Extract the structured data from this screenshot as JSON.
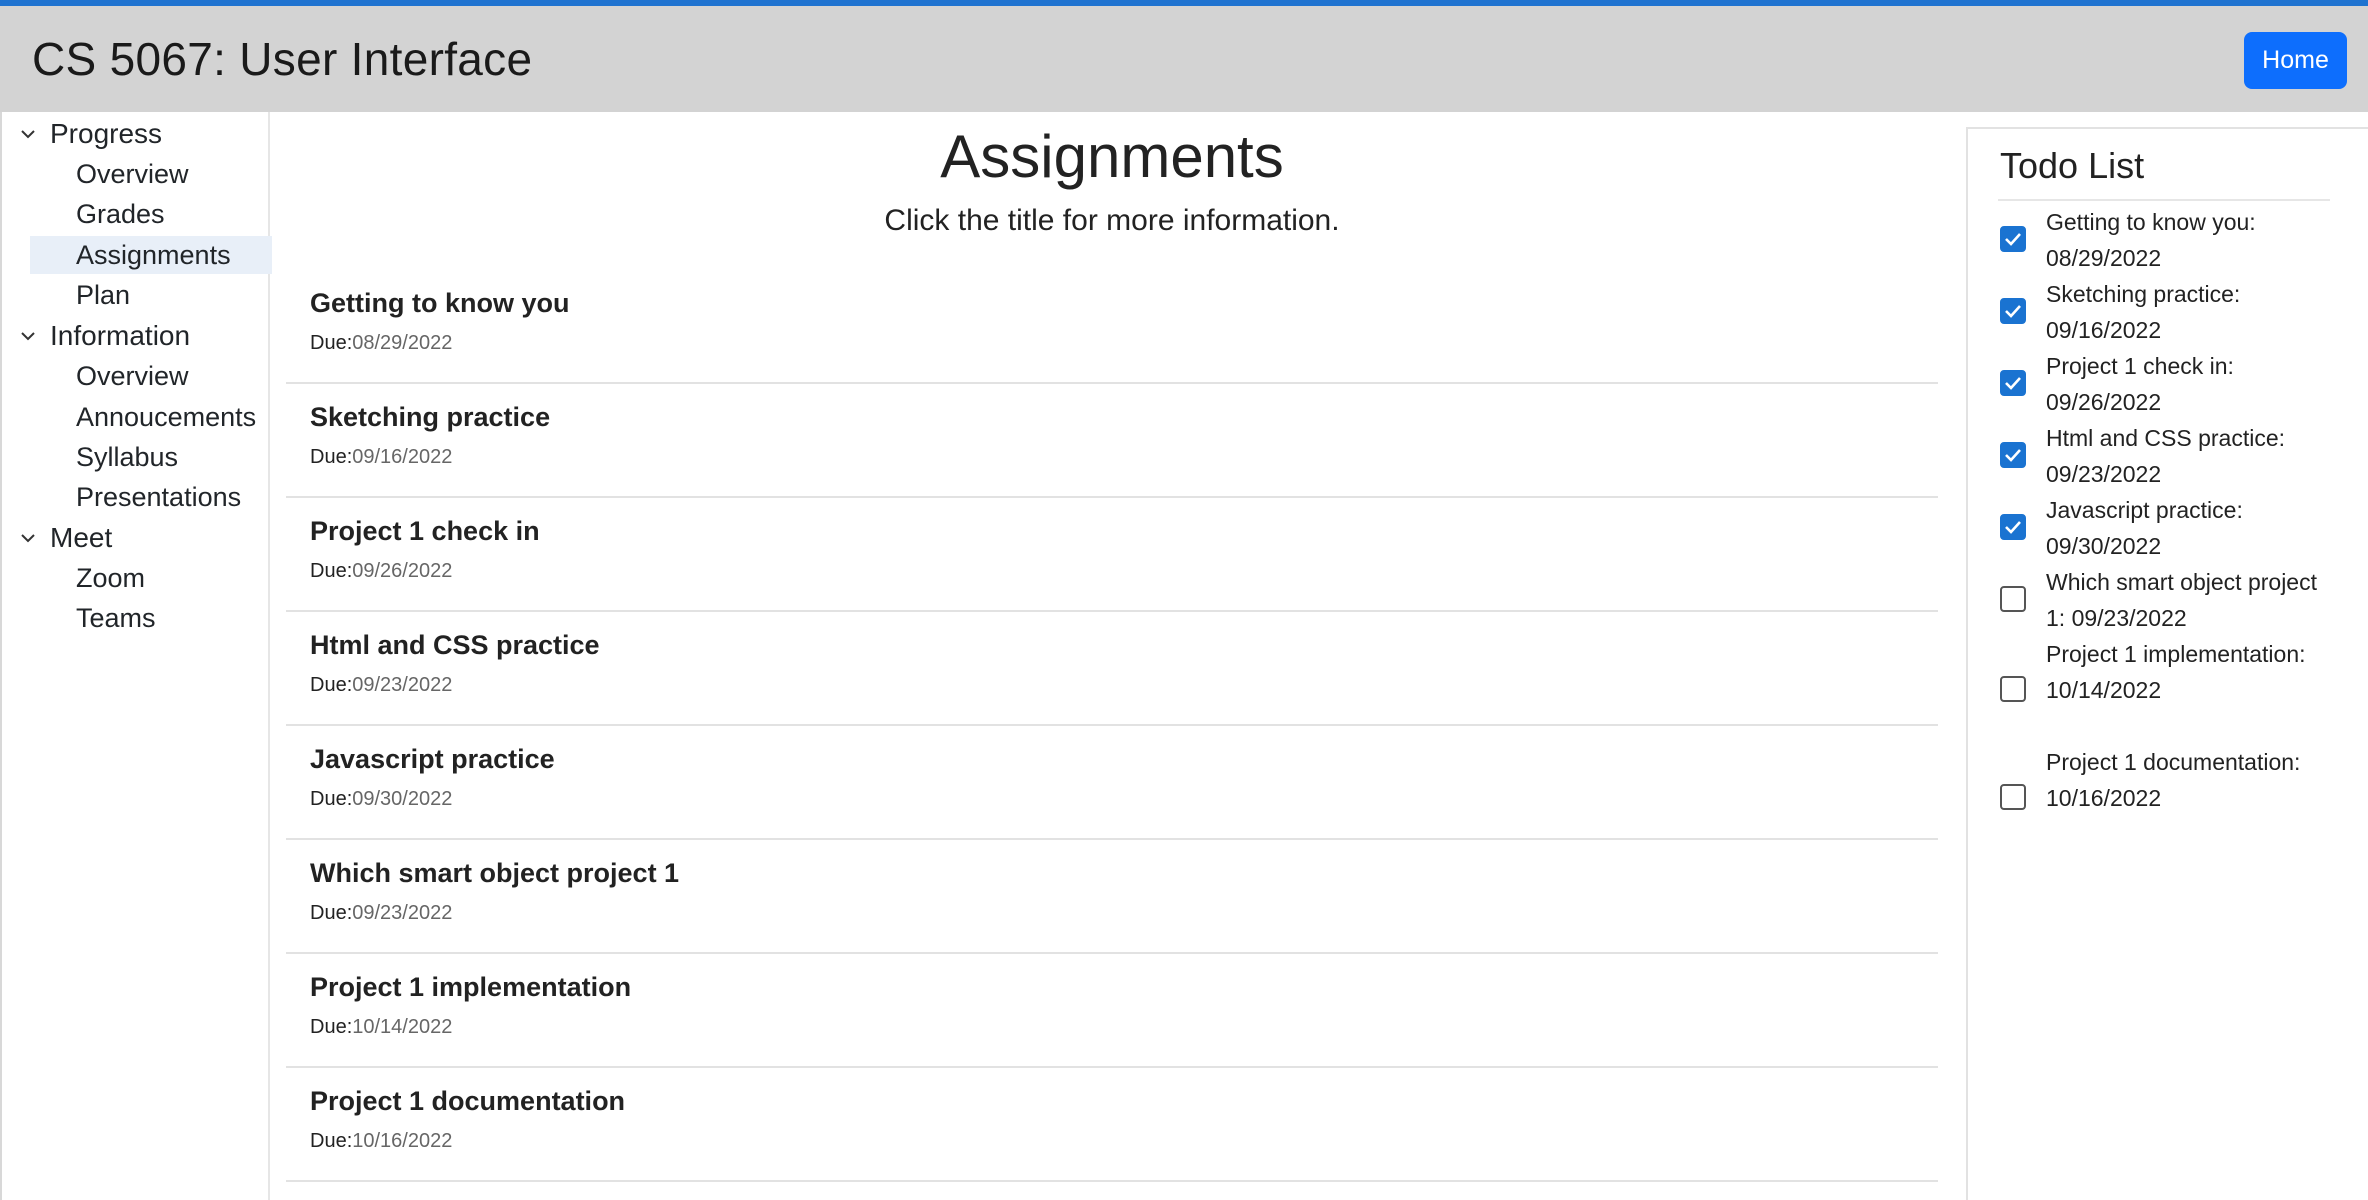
{
  "header": {
    "title": "CS 5067: User Interface",
    "home_label": "Home"
  },
  "sidebar": {
    "groups": [
      {
        "label": "Progress",
        "items": [
          "Overview",
          "Grades",
          "Assignments",
          "Plan"
        ]
      },
      {
        "label": "Information",
        "items": [
          "Overview",
          "Annoucements",
          "Syllabus",
          "Presentations"
        ]
      },
      {
        "label": "Meet",
        "items": [
          "Zoom",
          "Teams"
        ]
      }
    ],
    "active_item": "Assignments"
  },
  "main": {
    "title": "Assignments",
    "subtitle": "Click the title for more information.",
    "due_prefix": "Due:",
    "assignments": [
      {
        "title": "Getting to know you",
        "due": "08/29/2022"
      },
      {
        "title": "Sketching practice",
        "due": "09/16/2022"
      },
      {
        "title": "Project 1 check in",
        "due": "09/26/2022"
      },
      {
        "title": "Html and CSS practice",
        "due": "09/23/2022"
      },
      {
        "title": "Javascript practice",
        "due": "09/30/2022"
      },
      {
        "title": "Which smart object project 1",
        "due": "09/23/2022"
      },
      {
        "title": "Project 1 implementation",
        "due": "10/14/2022"
      },
      {
        "title": "Project 1 documentation",
        "due": "10/16/2022"
      }
    ]
  },
  "todo": {
    "title": "Todo List",
    "items": [
      {
        "text": "Getting to know you: 08/29/2022",
        "checked": true
      },
      {
        "text": "Sketching practice: 09/16/2022",
        "checked": true
      },
      {
        "text": "Project 1 check in: 09/26/2022",
        "checked": true
      },
      {
        "text": "Html and CSS practice: 09/23/2022",
        "checked": true
      },
      {
        "text": "Javascript practice: 09/30/2022",
        "checked": true
      },
      {
        "text": "Which smart object project 1: 09/23/2022",
        "checked": false
      },
      {
        "text": "Project 1 implementation: 10/14/2022",
        "checked": false
      },
      {
        "text": "Project 1 documentation: 10/16/2022",
        "checked": false
      }
    ]
  },
  "colors": {
    "accent": "#0d6efd",
    "header_bg": "#d3d3d3",
    "checkbox": "#1a73d1",
    "active_nav": "#e8eff8"
  }
}
